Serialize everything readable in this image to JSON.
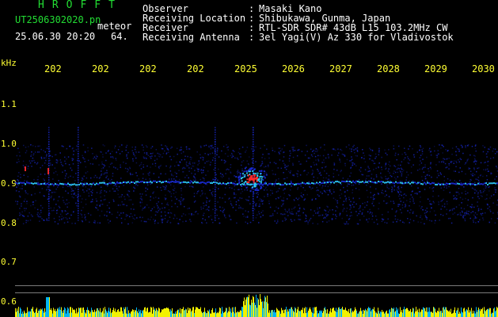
{
  "header": {
    "title": "HROFFT",
    "filename": "UT2506302020.pn",
    "meteor_label": "meteor",
    "datetime": "25.06.30 20:20",
    "count": "64.",
    "meta": [
      {
        "label": "Observer",
        "value": "Masaki Kano"
      },
      {
        "label": "Receiving Location",
        "value": "Shibukawa, Gunma, Japan"
      },
      {
        "label": "Receiver",
        "value": "RTL-SDR SDR# 43dB L15 103.2MHz CW"
      },
      {
        "label": "Receiving Antenna",
        "value": "3el Yagi(V) Az 330 for Vladivostok"
      }
    ],
    "colon": ":"
  },
  "axes": {
    "y_unit": "kHz",
    "x_ticks": [
      "202",
      "202",
      "202",
      "202",
      "2025",
      "2026",
      "2027",
      "2028",
      "2029",
      "2030"
    ],
    "y_ticks": [
      "1.1",
      "1.0",
      "0.9",
      "0.8",
      "0.7",
      "0.6"
    ]
  },
  "colors": {
    "background": "#000000",
    "header_text": "#ffffff",
    "title": "#22dd33",
    "axis_labels": "#ffff33",
    "signal_low": "#1a2bd8",
    "signal_mid": "#2fd0ff",
    "signal_hot": "#ff2a2a",
    "activity_bar": "#ffff00",
    "activity_fill": "#00bfff"
  }
}
